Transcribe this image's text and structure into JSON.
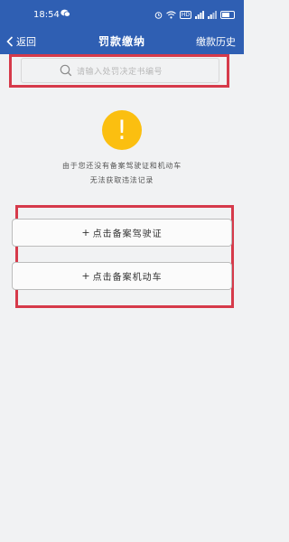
{
  "status_bar": {
    "time": "18:54",
    "network_badge": "HD"
  },
  "nav": {
    "back_label": "返回",
    "title": "罚款缴纳",
    "history_label": "缴款历史"
  },
  "search": {
    "placeholder": "请输入处罚决定书编号"
  },
  "warning": {
    "icon_glyph": "!",
    "line1": "由于您还没有备案驾驶证和机动车",
    "line2": "无法获取违法记录"
  },
  "actions": [
    {
      "plus": "+",
      "label": "点击备案驾驶证"
    },
    {
      "plus": "+",
      "label": "点击备案机动车"
    }
  ],
  "colors": {
    "header_blue": "#2f5fb3",
    "highlight_red": "#d63a4a",
    "warning_yellow": "#fbbf10",
    "background": "#f1f2f3"
  }
}
